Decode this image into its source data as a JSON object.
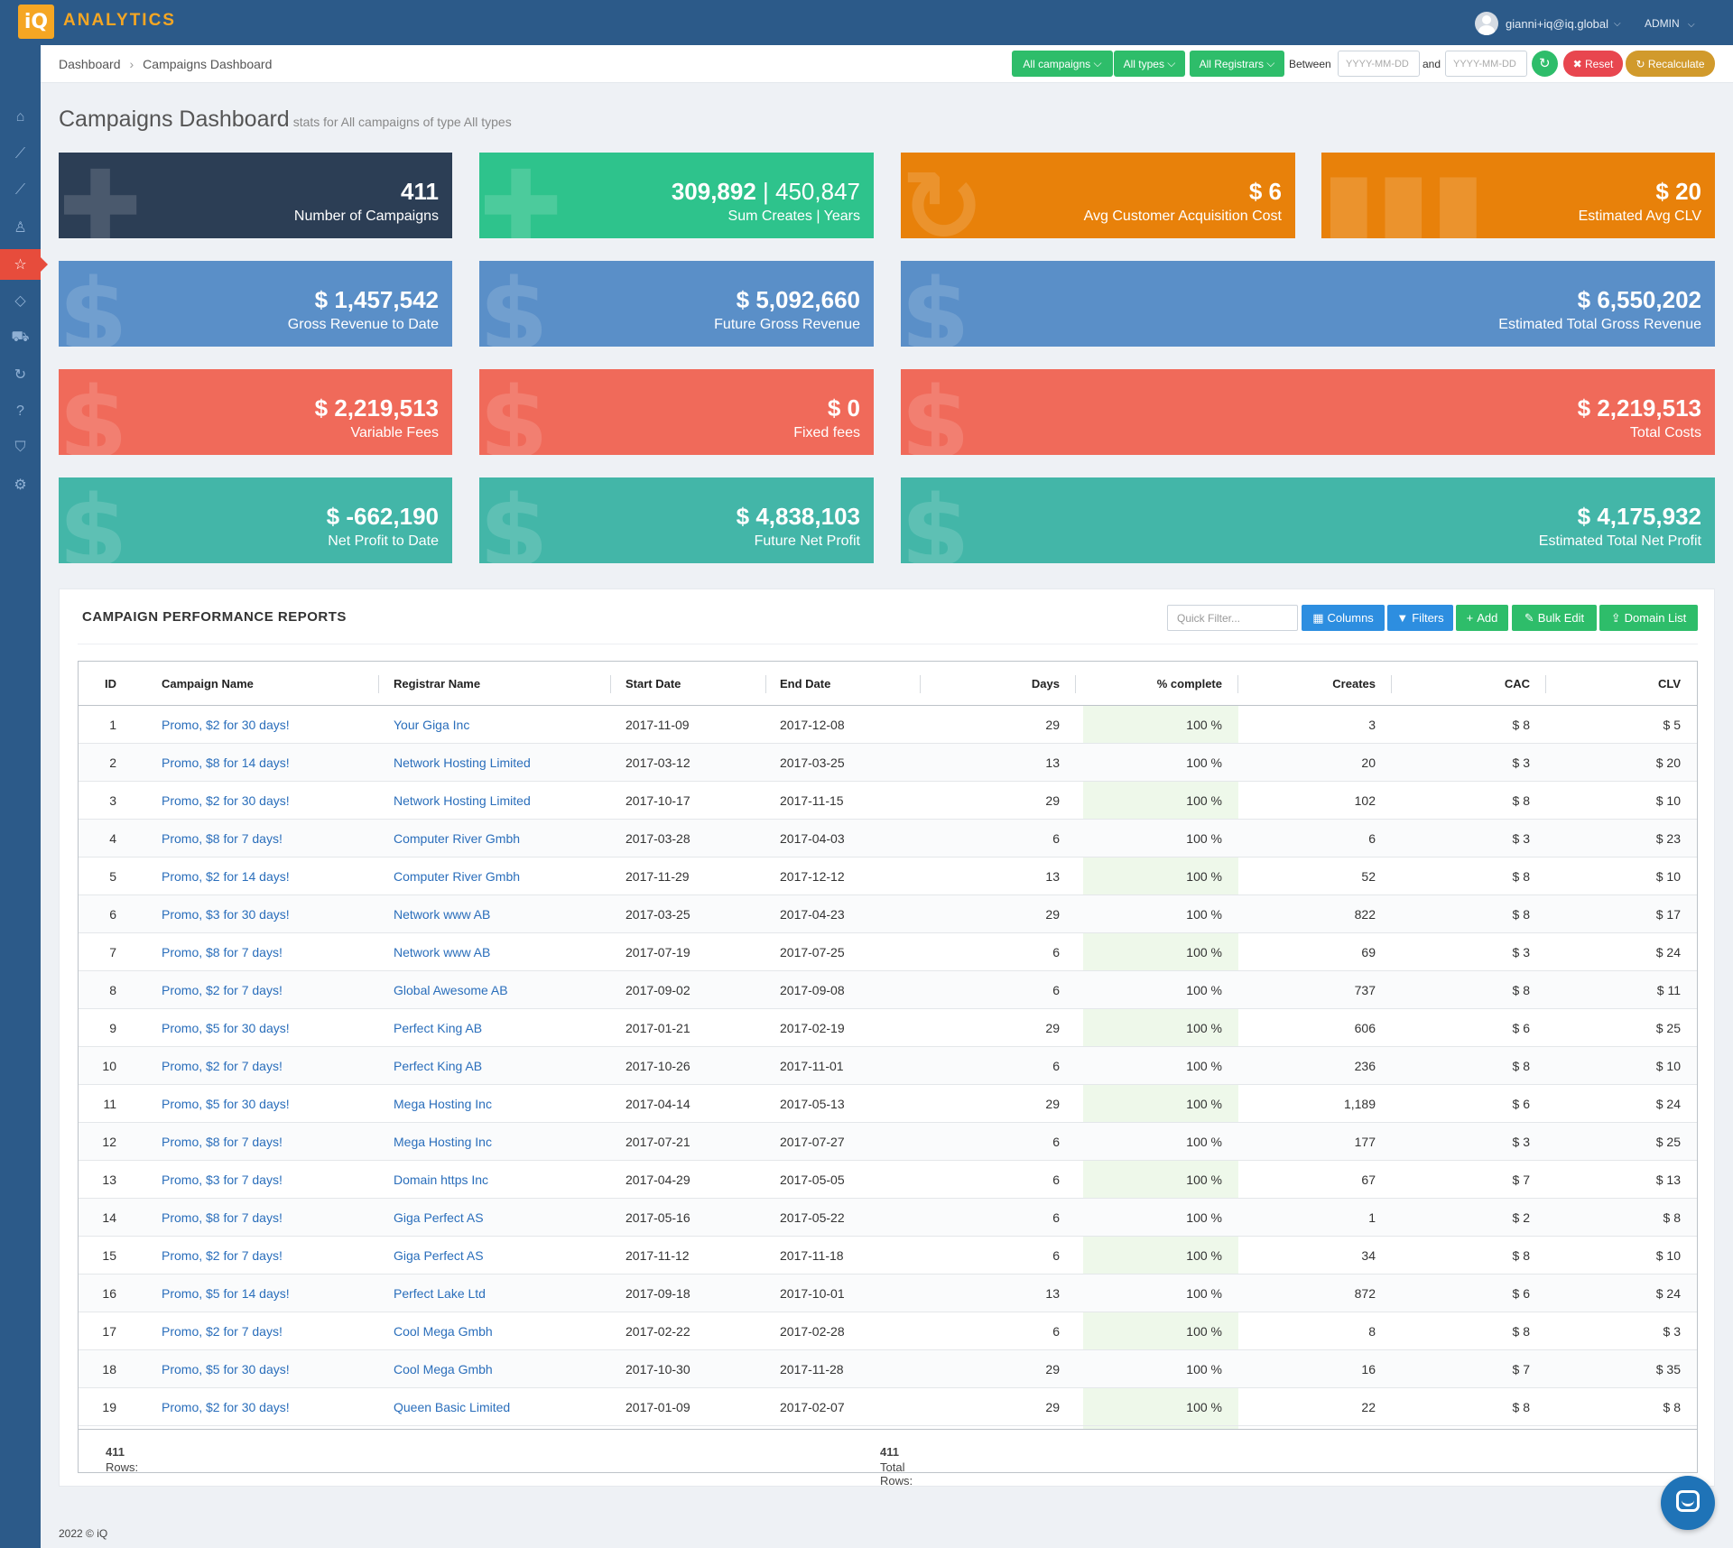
{
  "app": {
    "logo_glyph": "iQ",
    "logo_text": "ANALYTICS"
  },
  "user": {
    "email": "gianni+iq@iq.global",
    "role": "ADMIN"
  },
  "sidebar": {
    "icons": [
      "home-icon",
      "chart-line-icon",
      "chart-line-icon",
      "user-icon",
      "star-icon",
      "diamond-icon",
      "cart-icon",
      "refresh-icon",
      "question-icon",
      "shield-icon",
      "gear-icon"
    ],
    "active_index": 4
  },
  "breadcrumb": [
    "Dashboard",
    "Campaigns Dashboard"
  ],
  "filters": {
    "campaigns": "All campaigns",
    "types": "All types",
    "registrars": "All Registrars",
    "between_label": "Between",
    "and_label": "and",
    "date_placeholder": "YYYY-MM-DD",
    "reset_label": "Reset",
    "recalculate_label": "Recalculate"
  },
  "page": {
    "title": "Campaigns Dashboard",
    "subtitle": "stats for All campaigns of type All types"
  },
  "cards": [
    {
      "value": "411",
      "label": "Number of Campaigns"
    },
    {
      "value": "309,892",
      "value2": "450,847",
      "label": "Sum Creates",
      "label2": "Years"
    },
    {
      "value": "$ 6",
      "label": "Avg Customer Acquisition Cost"
    },
    {
      "value": "$ 20",
      "label": "Estimated Avg CLV"
    },
    {
      "value": "$ 1,457,542",
      "label": "Gross Revenue to Date"
    },
    {
      "value": "$ 5,092,660",
      "label": "Future Gross Revenue"
    },
    {
      "value": "$ 6,550,202",
      "label": "Estimated Total Gross Revenue"
    },
    {
      "value": "$ 2,219,513",
      "label": "Variable Fees"
    },
    {
      "value": "$ 0",
      "label": "Fixed fees"
    },
    {
      "value": "$ 2,219,513",
      "label": "Total Costs"
    },
    {
      "value": "$ -662,190",
      "label": "Net Profit to Date"
    },
    {
      "value": "$ 4,838,103",
      "label": "Future Net Profit"
    },
    {
      "value": "$ 4,175,932",
      "label": "Estimated Total Net Profit"
    }
  ],
  "panel": {
    "title": "CAMPAIGN PERFORMANCE REPORTS",
    "quick_filter_placeholder": "Quick Filter...",
    "buttons": {
      "columns": "Columns",
      "filters": "Filters",
      "add": "Add",
      "bulk_edit": "Bulk Edit",
      "domain_list": "Domain List"
    }
  },
  "table": {
    "headers": [
      "ID",
      "Campaign Name",
      "Registrar Name",
      "Start Date",
      "End Date",
      "Days",
      "% complete",
      "Creates",
      "CAC",
      "CLV"
    ],
    "rows": [
      [
        "1",
        "Promo, $2 for 30 days!",
        "Your Giga Inc",
        "2017-11-09",
        "2017-12-08",
        "29",
        "100 %",
        "3",
        "$ 8",
        "$ 5"
      ],
      [
        "2",
        "Promo, $8 for 14 days!",
        "Network Hosting Limited",
        "2017-03-12",
        "2017-03-25",
        "13",
        "100 %",
        "20",
        "$ 3",
        "$ 20"
      ],
      [
        "3",
        "Promo, $2 for 30 days!",
        "Network Hosting Limited",
        "2017-10-17",
        "2017-11-15",
        "29",
        "100 %",
        "102",
        "$ 8",
        "$ 10"
      ],
      [
        "4",
        "Promo, $8 for 7 days!",
        "Computer River Gmbh",
        "2017-03-28",
        "2017-04-03",
        "6",
        "100 %",
        "6",
        "$ 3",
        "$ 23"
      ],
      [
        "5",
        "Promo, $2 for 14 days!",
        "Computer River Gmbh",
        "2017-11-29",
        "2017-12-12",
        "13",
        "100 %",
        "52",
        "$ 8",
        "$ 10"
      ],
      [
        "6",
        "Promo, $3 for 30 days!",
        "Network www AB",
        "2017-03-25",
        "2017-04-23",
        "29",
        "100 %",
        "822",
        "$ 8",
        "$ 17"
      ],
      [
        "7",
        "Promo, $8 for 7 days!",
        "Network www AB",
        "2017-07-19",
        "2017-07-25",
        "6",
        "100 %",
        "69",
        "$ 3",
        "$ 24"
      ],
      [
        "8",
        "Promo, $2 for 7 days!",
        "Global Awesome AB",
        "2017-09-02",
        "2017-09-08",
        "6",
        "100 %",
        "737",
        "$ 8",
        "$ 11"
      ],
      [
        "9",
        "Promo, $5 for 30 days!",
        "Perfect King AB",
        "2017-01-21",
        "2017-02-19",
        "29",
        "100 %",
        "606",
        "$ 6",
        "$ 25"
      ],
      [
        "10",
        "Promo, $2 for 7 days!",
        "Perfect King AB",
        "2017-10-26",
        "2017-11-01",
        "6",
        "100 %",
        "236",
        "$ 8",
        "$ 10"
      ],
      [
        "11",
        "Promo, $5 for 30 days!",
        "Mega Hosting Inc",
        "2017-04-14",
        "2017-05-13",
        "29",
        "100 %",
        "1,189",
        "$ 6",
        "$ 24"
      ],
      [
        "12",
        "Promo, $8 for 7 days!",
        "Mega Hosting Inc",
        "2017-07-21",
        "2017-07-27",
        "6",
        "100 %",
        "177",
        "$ 3",
        "$ 25"
      ],
      [
        "13",
        "Promo, $3 for 7 days!",
        "Domain https Inc",
        "2017-04-29",
        "2017-05-05",
        "6",
        "100 %",
        "67",
        "$ 7",
        "$ 13"
      ],
      [
        "14",
        "Promo, $8 for 7 days!",
        "Giga Perfect AS",
        "2017-05-16",
        "2017-05-22",
        "6",
        "100 %",
        "1",
        "$ 2",
        "$ 8"
      ],
      [
        "15",
        "Promo, $2 for 7 days!",
        "Giga Perfect AS",
        "2017-11-12",
        "2017-11-18",
        "6",
        "100 %",
        "34",
        "$ 8",
        "$ 10"
      ],
      [
        "16",
        "Promo, $5 for 14 days!",
        "Perfect Lake Ltd",
        "2017-09-18",
        "2017-10-01",
        "13",
        "100 %",
        "872",
        "$ 6",
        "$ 24"
      ],
      [
        "17",
        "Promo, $2 for 7 days!",
        "Cool Mega Gmbh",
        "2017-02-22",
        "2017-02-28",
        "6",
        "100 %",
        "8",
        "$ 8",
        "$ 3"
      ],
      [
        "18",
        "Promo, $5 for 30 days!",
        "Cool Mega Gmbh",
        "2017-10-30",
        "2017-11-28",
        "29",
        "100 %",
        "16",
        "$ 7",
        "$ 35"
      ],
      [
        "19",
        "Promo, $2 for 30 days!",
        "Queen Basic Limited",
        "2017-01-09",
        "2017-02-07",
        "29",
        "100 %",
        "22",
        "$ 8",
        "$ 8"
      ]
    ],
    "footer": {
      "rows_label": "Rows:",
      "rows_value": "411",
      "total_label": "Total Rows:",
      "total_value": "411"
    }
  },
  "footer": {
    "copyright": "2022 © iQ"
  }
}
